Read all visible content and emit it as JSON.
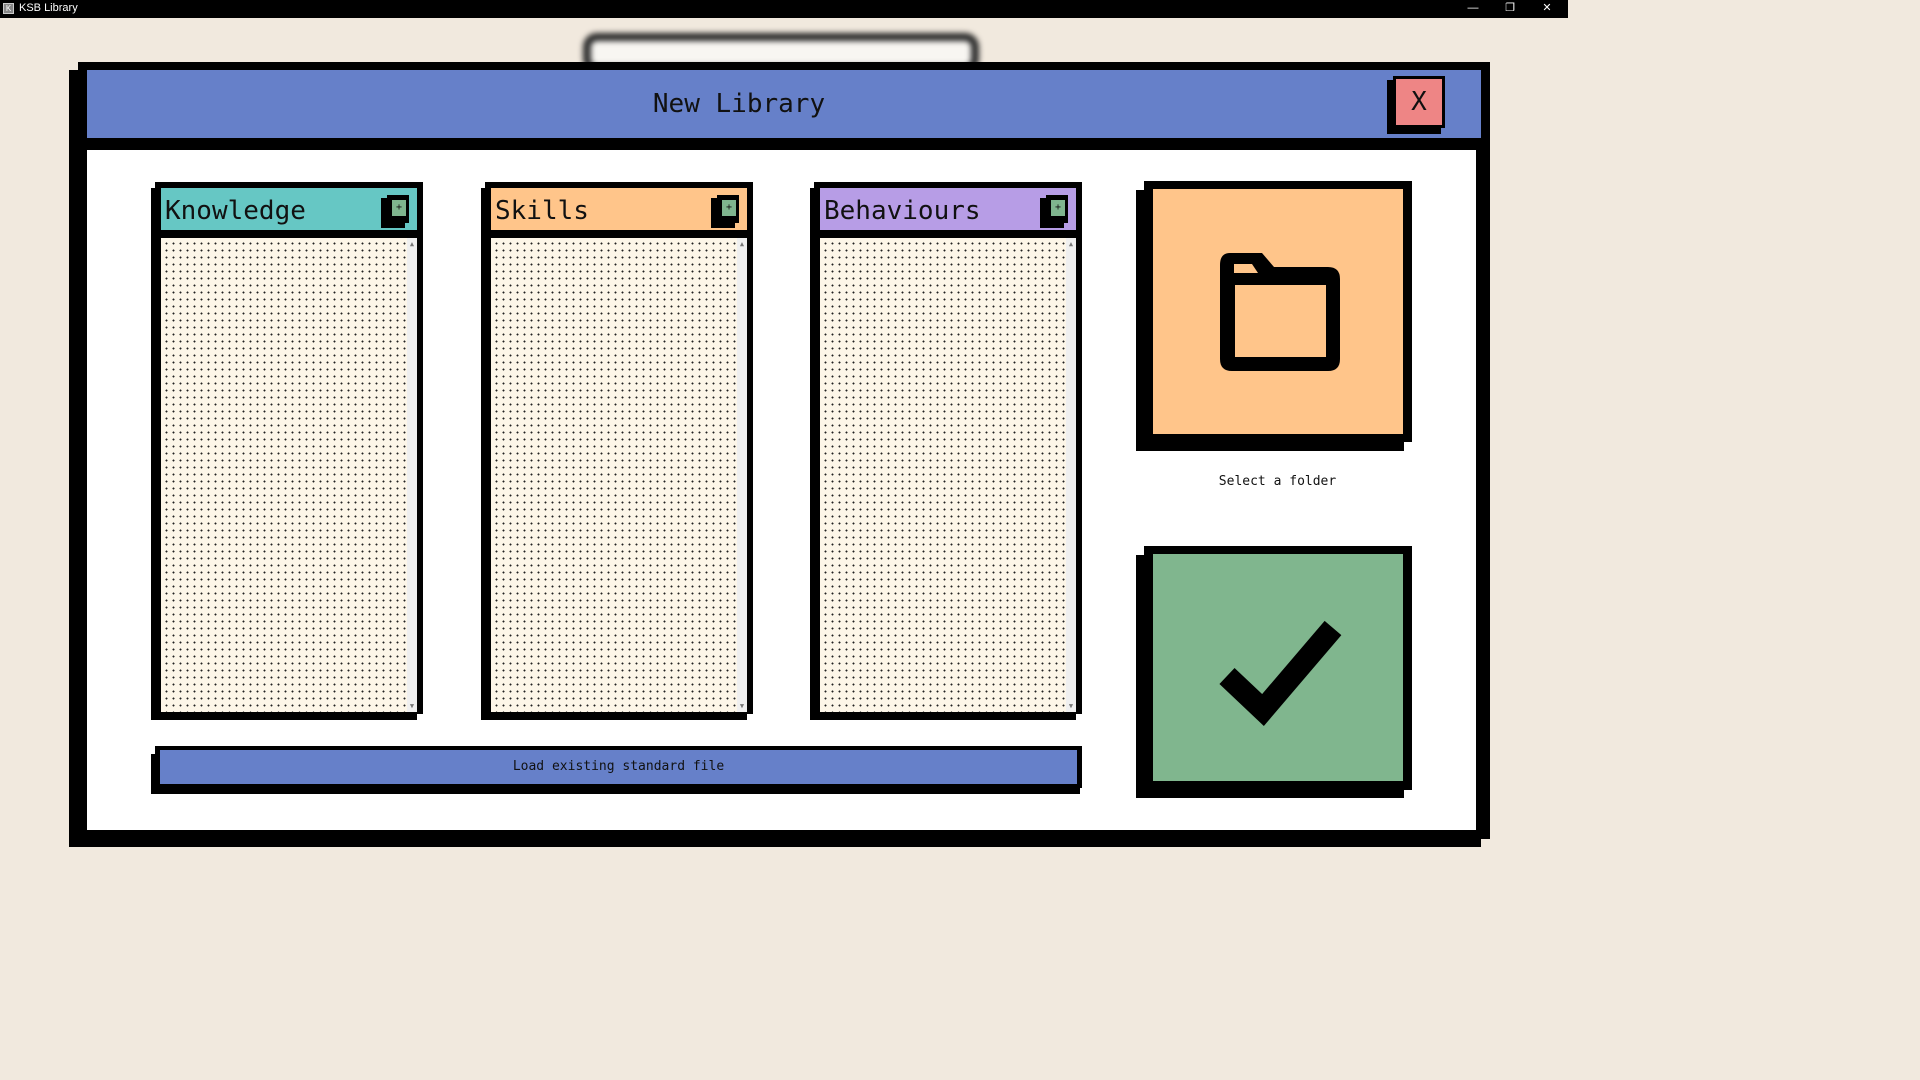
{
  "window": {
    "title": "KSB Library",
    "app_icon_glyph": "K",
    "controls": {
      "minimize": "—",
      "restore": "❐",
      "close": "✕"
    }
  },
  "dialog": {
    "title": "New Library",
    "close_label": "X"
  },
  "columns": [
    {
      "title": "Knowledge",
      "add_label": "+",
      "color": "#66c7c4"
    },
    {
      "title": "Skills",
      "add_label": "+",
      "color": "#ffc58a"
    },
    {
      "title": "Behaviours",
      "add_label": "+",
      "color": "#b79de6"
    }
  ],
  "load_button": {
    "label": "Load existing standard file"
  },
  "folder": {
    "label": "Select a folder",
    "icon": "folder-icon",
    "color": "#ffc58a"
  },
  "confirm": {
    "icon": "checkmark-icon",
    "color": "#80b68e"
  },
  "colors": {
    "accent_blue": "#6680c9",
    "close_red": "#ee8585",
    "list_bg": "#fdf6e8",
    "backdrop": "#f1e9de"
  }
}
